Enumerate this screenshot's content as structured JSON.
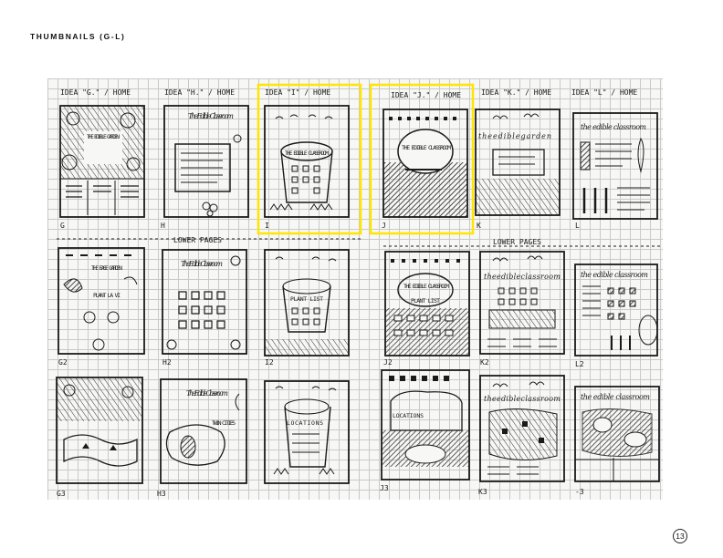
{
  "heading": "THUMBNAILS (G-L)",
  "page_number": "13",
  "highlight_color": "#ffe600",
  "columns": [
    {
      "label": "IDEA \"G.\" / HOME",
      "row1_id": "G",
      "row2_id": "G2",
      "row3_id": "G3"
    },
    {
      "label": "IDEA \"H.\" / HOME",
      "row1_id": "H",
      "row2_id": "H2",
      "row3_id": "H3"
    },
    {
      "label": "IDEA \"I\" / HOME",
      "row1_id": "I",
      "row2_id": "I2",
      "row3_id": ""
    },
    {
      "label": "IDEA \"J.\" / HOME",
      "row1_id": "J",
      "row2_id": "J2",
      "row3_id": "J3"
    },
    {
      "label": "IDEA \"K.\" / HOME",
      "row1_id": "K",
      "row2_id": "K2",
      "row3_id": "K3"
    },
    {
      "label": "IDEA \"L\" / HOME",
      "row1_id": "L",
      "row2_id": "L2",
      "row3_id": "-3"
    }
  ],
  "lower_pages_label": "LOWER PAGES",
  "sketch_text": {
    "g_title": "THE EDIBLE GARDEN",
    "g2_title": "THE EASE GARDEN",
    "g2_sub": "PLANT LA VI",
    "h_title": "The Edible Classroom",
    "h2_title": "The Edible Classroom",
    "h3_title": "The Edible Classroom",
    "h3_sub": "TWIN CITIES",
    "i_banner": "THE EDIBLE CLASSROOM",
    "i2_banner": "PLANT LIST",
    "i3_banner": "LOCATIONS",
    "j_title": "THE EDIBLE CLASSROOM",
    "j2_title": "THE EDIBLE CLASSROOM",
    "j2_sub": "PLANT LIST",
    "j3_sub": "LOCATIONS",
    "k_title": "theediblegarden",
    "k2_title": "theedibleclassroom",
    "k3_title": "theedibleclassroom",
    "l_title": "the edible classroom",
    "l2_title": "the edible classroom",
    "l3_title": "the edible classroom"
  }
}
